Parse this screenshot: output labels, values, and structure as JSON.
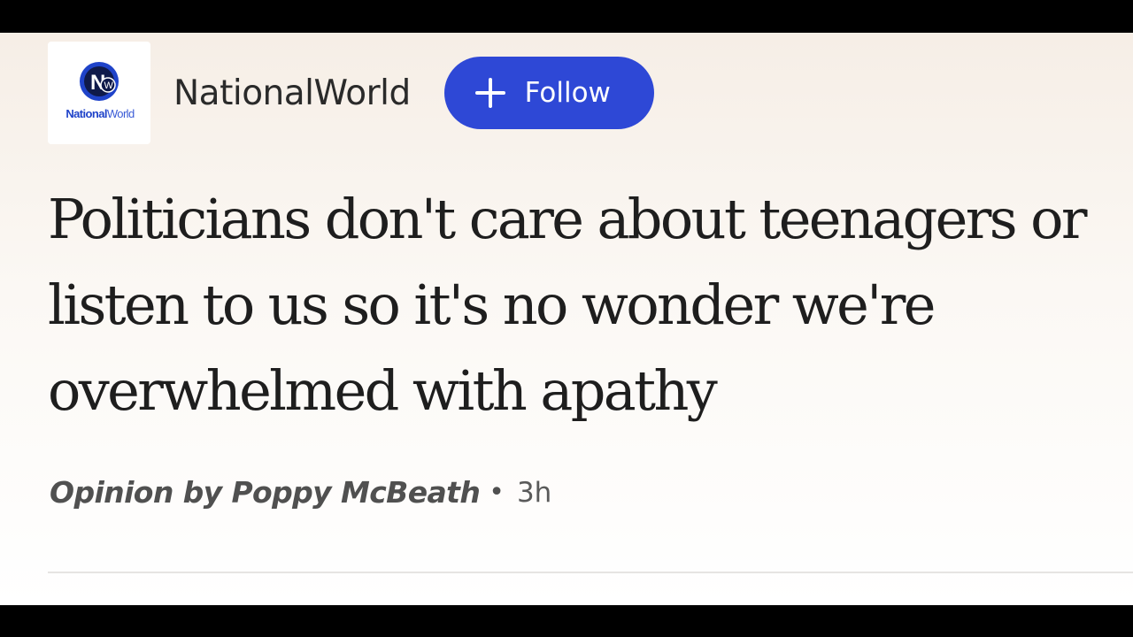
{
  "publisher": {
    "name": "NationalWorld",
    "logo_text_bold": "National",
    "logo_text_light": "World",
    "logo_mark": "NW",
    "accent_color": "#2e48d6"
  },
  "follow_button": {
    "icon": "plus-icon",
    "label": "Follow"
  },
  "article": {
    "headline": "Politicians don't care about teenagers or listen to us so it's no wonder we're overwhelmed with apathy",
    "byline": "Opinion by Poppy McBeath",
    "separator": "•",
    "age": "3h"
  }
}
